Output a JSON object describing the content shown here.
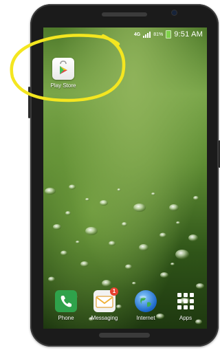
{
  "status_bar": {
    "network": "4G",
    "battery": "81%",
    "time": "9:51 AM"
  },
  "home": {
    "top_apps": [
      {
        "label": "Play Store",
        "icon": "play-store-icon"
      }
    ],
    "dock": [
      {
        "label": "Phone",
        "icon": "phone-icon"
      },
      {
        "label": "Messaging",
        "icon": "messaging-icon",
        "badge": "1"
      },
      {
        "label": "Internet",
        "icon": "globe-icon"
      },
      {
        "label": "Apps",
        "icon": "apps-grid-icon"
      }
    ]
  },
  "colors": {
    "annotation_circle": "#f4e620",
    "phone_body": "#1b1b1b",
    "wallpaper": "#6d9a3c"
  }
}
